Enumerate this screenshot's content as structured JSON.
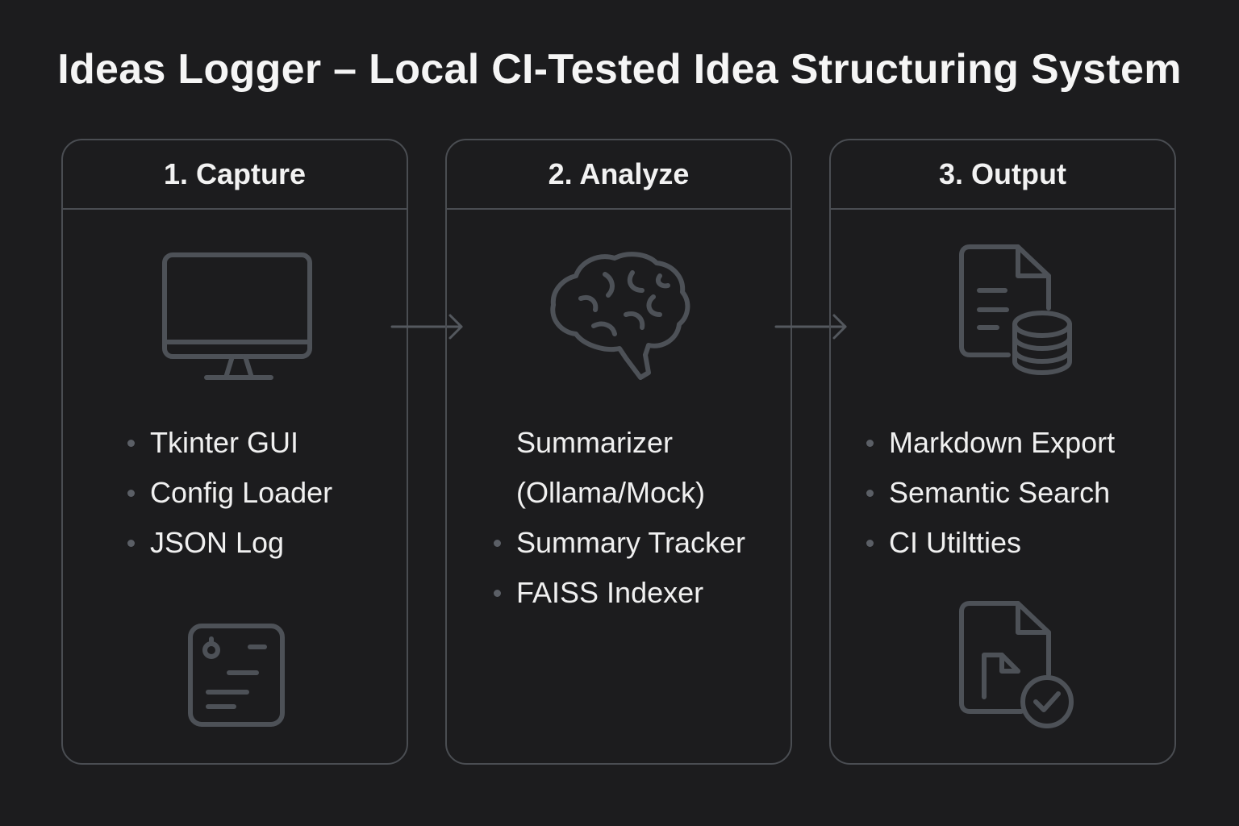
{
  "title": "Ideas Logger – Local CI-Tested Idea Structuring System",
  "panels": [
    {
      "heading": "1. Capture",
      "icons": [
        "monitor-icon",
        "log-note-icon"
      ],
      "items": [
        {
          "text": "Tkinter GUI",
          "bullet": true
        },
        {
          "text": "Config Loader",
          "bullet": true
        },
        {
          "text": "JSON Log",
          "bullet": true
        }
      ]
    },
    {
      "heading": "2. Analyze",
      "icons": [
        "brain-icon"
      ],
      "items": [
        {
          "text": "Summarizer",
          "bullet": false
        },
        {
          "text": "(Ollama/Mock)",
          "bullet": false
        },
        {
          "text": "Summary Tracker",
          "bullet": true
        },
        {
          "text": "FAISS Indexer",
          "bullet": true
        }
      ]
    },
    {
      "heading": "3. Output",
      "icons": [
        "document-database-icon",
        "file-check-icon"
      ],
      "items": [
        {
          "text": "Markdown Export",
          "bullet": true
        },
        {
          "text": "Semantic Search",
          "bullet": true
        },
        {
          "text": "CI Utiltties",
          "bullet": true
        }
      ]
    }
  ],
  "connectors": [
    "arrow-right-icon",
    "arrow-right-icon"
  ],
  "colors": {
    "background": "#1c1c1e",
    "border": "#4a4d52",
    "icon_stroke": "#4d5157",
    "text": "#f0f0f0"
  }
}
